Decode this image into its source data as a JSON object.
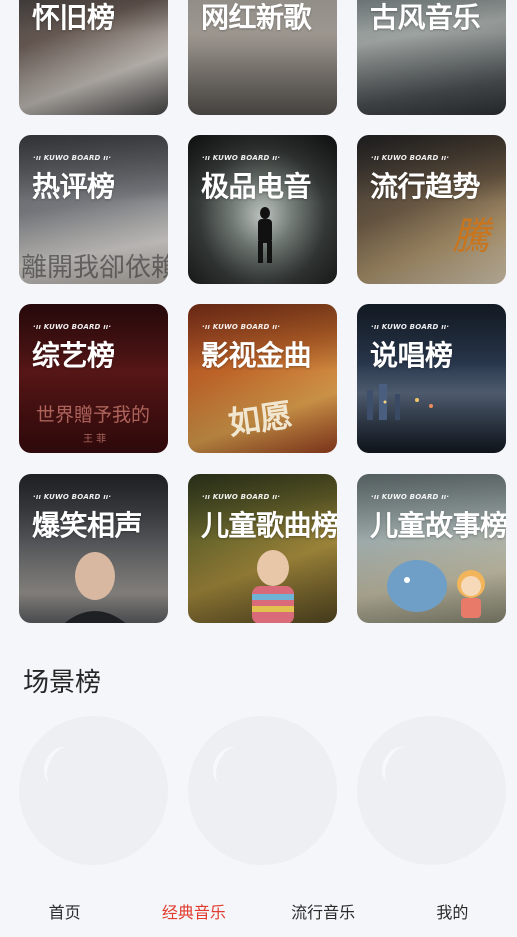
{
  "boards": {
    "brand_label": "·ıı KUWO BOARD ıı·",
    "rows": [
      [
        {
          "title": "怀旧榜",
          "bg": "bg-nostalgia"
        },
        {
          "title": "网红新歌",
          "bg": "bg-viral"
        },
        {
          "title": "古风音乐",
          "bg": "bg-ancient"
        }
      ],
      [
        {
          "title": "热评榜",
          "bg": "bg-hotcomment",
          "art_text": "離開我卻依賴"
        },
        {
          "title": "极品电音",
          "bg": "bg-premium"
        },
        {
          "title": "流行趋势",
          "bg": "bg-trending",
          "art_text": "騰"
        }
      ],
      [
        {
          "title": "综艺榜",
          "bg": "bg-variety",
          "art_text": "世界贈予我的",
          "art_subtext": "王 菲"
        },
        {
          "title": "影视金曲",
          "bg": "bg-film",
          "art_text": "如愿"
        },
        {
          "title": "说唱榜",
          "bg": "bg-rap"
        }
      ],
      [
        {
          "title": "爆笑相声",
          "bg": "bg-comedy"
        },
        {
          "title": "儿童歌曲榜",
          "bg": "bg-kidsongs"
        },
        {
          "title": "儿童故事榜",
          "bg": "bg-kidstories"
        }
      ]
    ]
  },
  "scene_section": {
    "title": "场景榜",
    "placeholders": 3
  },
  "tabbar": {
    "tabs": [
      {
        "label": "首页",
        "active": false
      },
      {
        "label": "经典音乐",
        "active": true
      },
      {
        "label": "流行音乐",
        "active": false
      },
      {
        "label": "我的",
        "active": false
      }
    ],
    "active_color": "#e23b2e"
  }
}
